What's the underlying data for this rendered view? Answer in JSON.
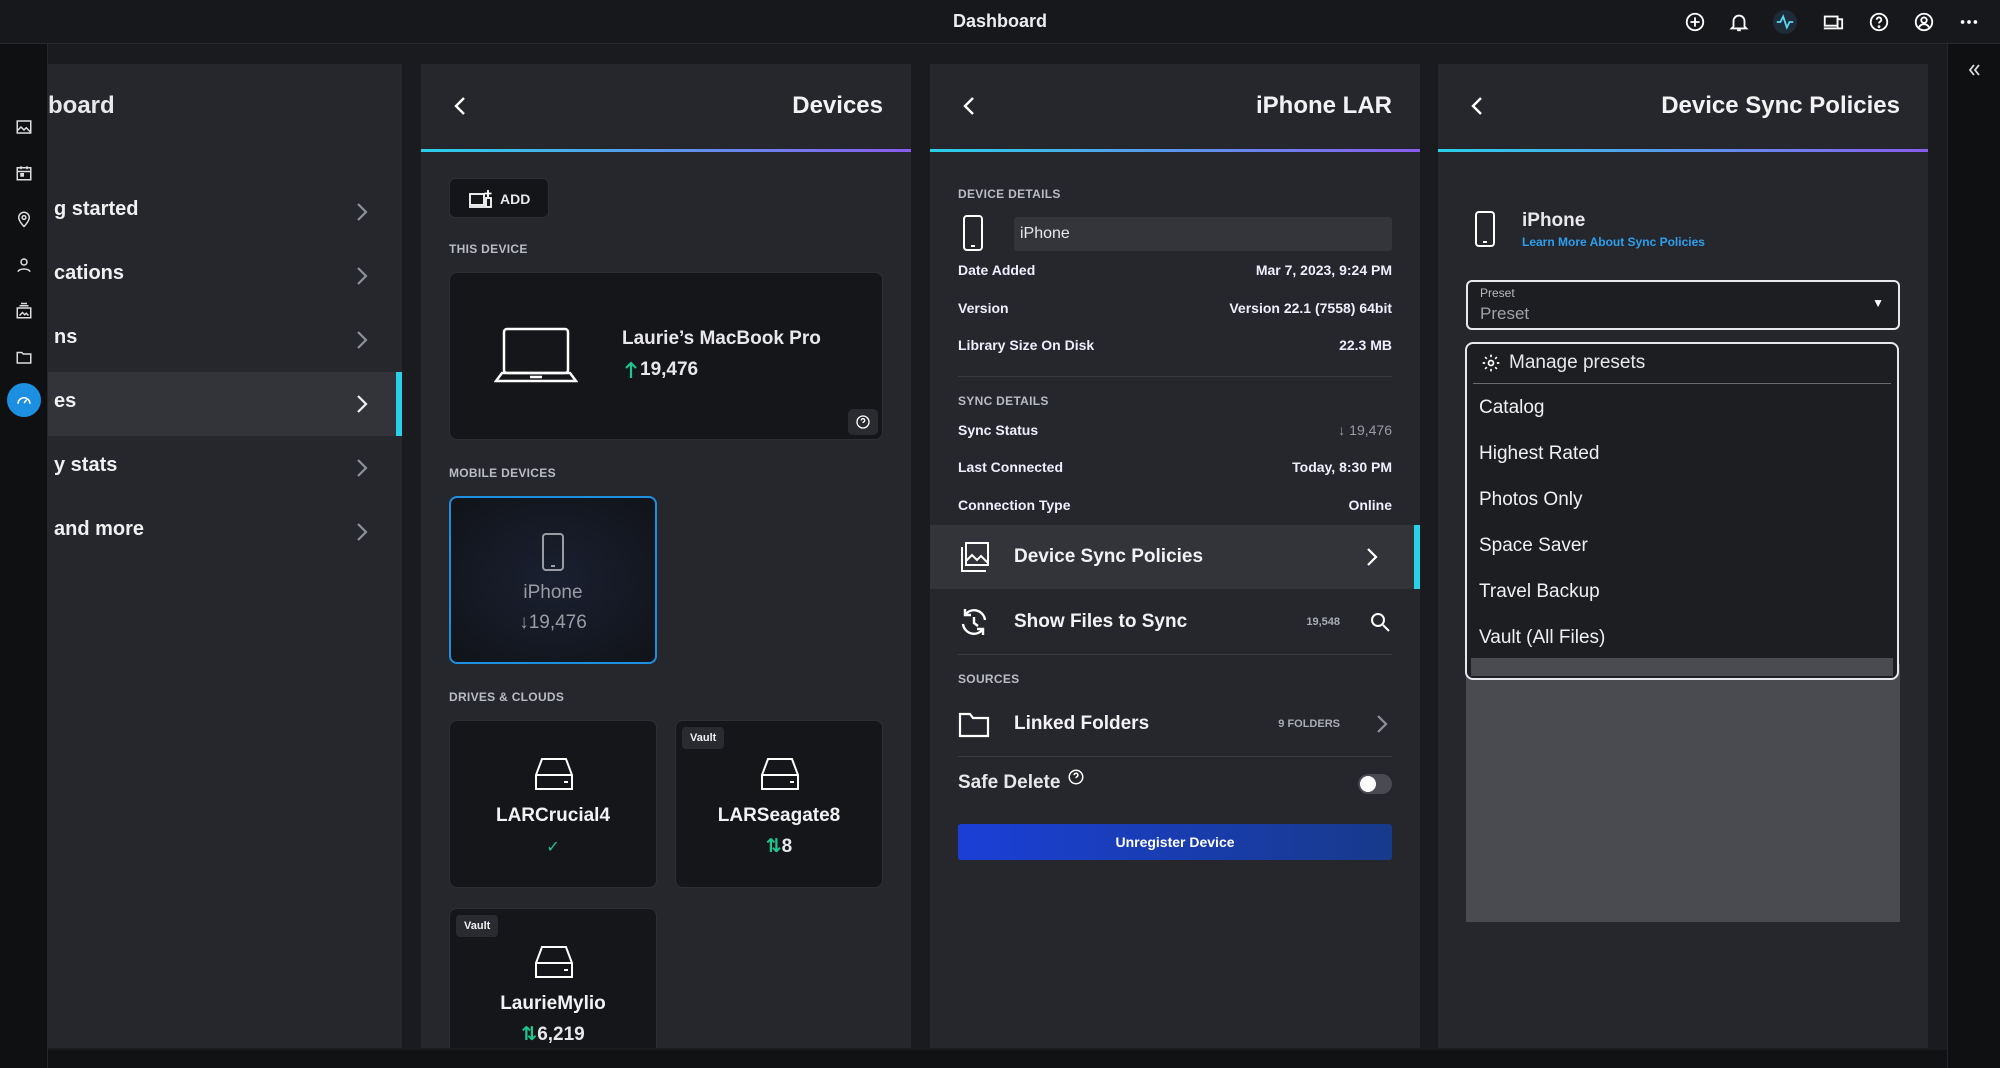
{
  "app": {
    "title": "Dashboard"
  },
  "topbar": {
    "icons": [
      "add-circle-icon",
      "bell-icon",
      "activity-icon",
      "devices-icon",
      "help-icon",
      "account-icon",
      "more-icon"
    ]
  },
  "colors": {
    "accent": "#2ad0e8",
    "accent2": "#8a5cf0",
    "active_blue": "#1d8fe1",
    "green": "#1fc58e",
    "unregister_btn": "#1b3fd6"
  },
  "dashboard": {
    "title": "board",
    "items": [
      {
        "label": "g started"
      },
      {
        "label": "cations"
      },
      {
        "label": "ns"
      },
      {
        "label": "es"
      },
      {
        "label": "y stats"
      },
      {
        "label": "and more"
      }
    ]
  },
  "devices": {
    "title": "Devices",
    "add_label": "ADD",
    "this_device_section": "THIS DEVICE",
    "this_device": {
      "name": "Laurie’s MacBook Pro",
      "count": "19,476"
    },
    "mobile_section": "MOBILE DEVICES",
    "mobile": {
      "name": "iPhone",
      "count": "19,476"
    },
    "drives_section": "DRIVES & CLOUDS",
    "drives": [
      {
        "name": "LARCrucial4",
        "badge": "",
        "count": ""
      },
      {
        "name": "LARSeagate8",
        "badge": "Vault",
        "count": "8"
      },
      {
        "name": "LaurieMylio",
        "badge": "Vault",
        "count": "6,219"
      }
    ]
  },
  "iphone": {
    "title": "iPhone LAR",
    "details_section": "DEVICE DETAILS",
    "name_value": "iPhone",
    "date_added": {
      "label": "Date Added",
      "value": "Mar 7, 2023, 9:24 PM"
    },
    "version": {
      "label": "Version",
      "value": "Version 22.1 (7558) 64bit"
    },
    "library_size": {
      "label": "Library Size On Disk",
      "value": "22.3 MB"
    },
    "sync_section": "SYNC DETAILS",
    "sync_status": {
      "label": "Sync Status",
      "value": "19,476"
    },
    "last_connected": {
      "label": "Last Connected",
      "value": "Today, 8:30 PM"
    },
    "connection_type": {
      "label": "Connection Type",
      "value": "Online"
    },
    "sync_policies_label": "Device Sync Policies",
    "show_files_label": "Show Files to Sync",
    "show_files_count": "19,548",
    "sources_section": "SOURCES",
    "linked_folders_label": "Linked Folders",
    "linked_folders_count": "9 FOLDERS",
    "safe_delete_label": "Safe Delete",
    "unregister_label": "Unregister Device"
  },
  "sync_policies": {
    "title": "Device Sync Policies",
    "device_name": "iPhone",
    "learn_more": "Learn More About Sync Policies",
    "preset_label": "Preset",
    "preset_value": "Preset",
    "manage_presets": "Manage presets",
    "options": [
      "Catalog",
      "Highest Rated",
      "Photos Only",
      "Space Saver",
      "Travel Backup",
      "Vault (All Files)"
    ]
  }
}
